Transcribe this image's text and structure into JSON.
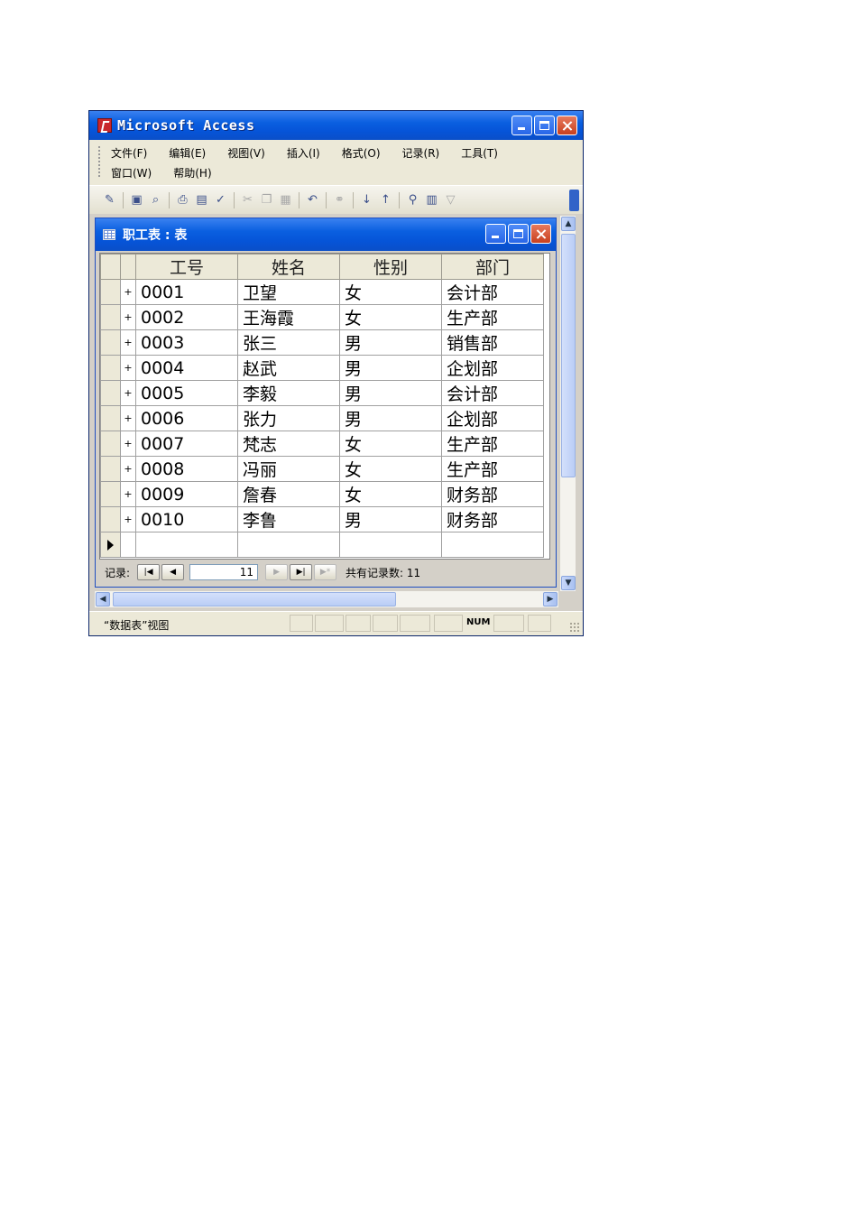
{
  "app": {
    "title": "Microsoft Access"
  },
  "menu": {
    "row1": [
      "文件(F)",
      "编辑(E)",
      "视图(V)",
      "插入(I)",
      "格式(O)",
      "记录(R)",
      "工具(T)"
    ],
    "row2": [
      "窗口(W)",
      "帮助(H)"
    ]
  },
  "toolbar": {
    "icons": [
      "design-view-icon",
      "save-icon",
      "search-icon",
      "print-icon",
      "print-preview-icon",
      "spelling-icon",
      "cut-icon",
      "copy-icon",
      "paste-icon",
      "undo-icon",
      "insert-hyperlink-icon",
      "sort-ascending-icon",
      "sort-descending-icon",
      "filter-by-selection-icon",
      "filter-by-form-icon",
      "apply-filter-icon"
    ]
  },
  "table_window": {
    "title": "职工表 : 表",
    "columns": [
      "工号",
      "姓名",
      "性别",
      "部门"
    ],
    "rows": [
      [
        "0001",
        "卫望",
        "女",
        "会计部"
      ],
      [
        "0002",
        "王海霞",
        "女",
        "生产部"
      ],
      [
        "0003",
        "张三",
        "男",
        "销售部"
      ],
      [
        "0004",
        "赵武",
        "男",
        "企划部"
      ],
      [
        "0005",
        "李毅",
        "男",
        "会计部"
      ],
      [
        "0006",
        "张力",
        "男",
        "企划部"
      ],
      [
        "0007",
        "梵志",
        "女",
        "生产部"
      ],
      [
        "0008",
        "冯丽",
        "女",
        "生产部"
      ],
      [
        "0009",
        "詹春",
        "女",
        "财务部"
      ],
      [
        "0010",
        "李鲁",
        "男",
        "财务部"
      ]
    ],
    "expand_glyph": "+"
  },
  "navigator": {
    "label": "记录:",
    "current": "11",
    "total_text": "共有记录数: 11"
  },
  "status": {
    "view_text": "“数据表”视图",
    "num_indicator": "NUM"
  },
  "colors": {
    "title_bar": "#0a5fe0",
    "menu_bg": "#ece9d8",
    "close_btn": "#c8401e"
  }
}
